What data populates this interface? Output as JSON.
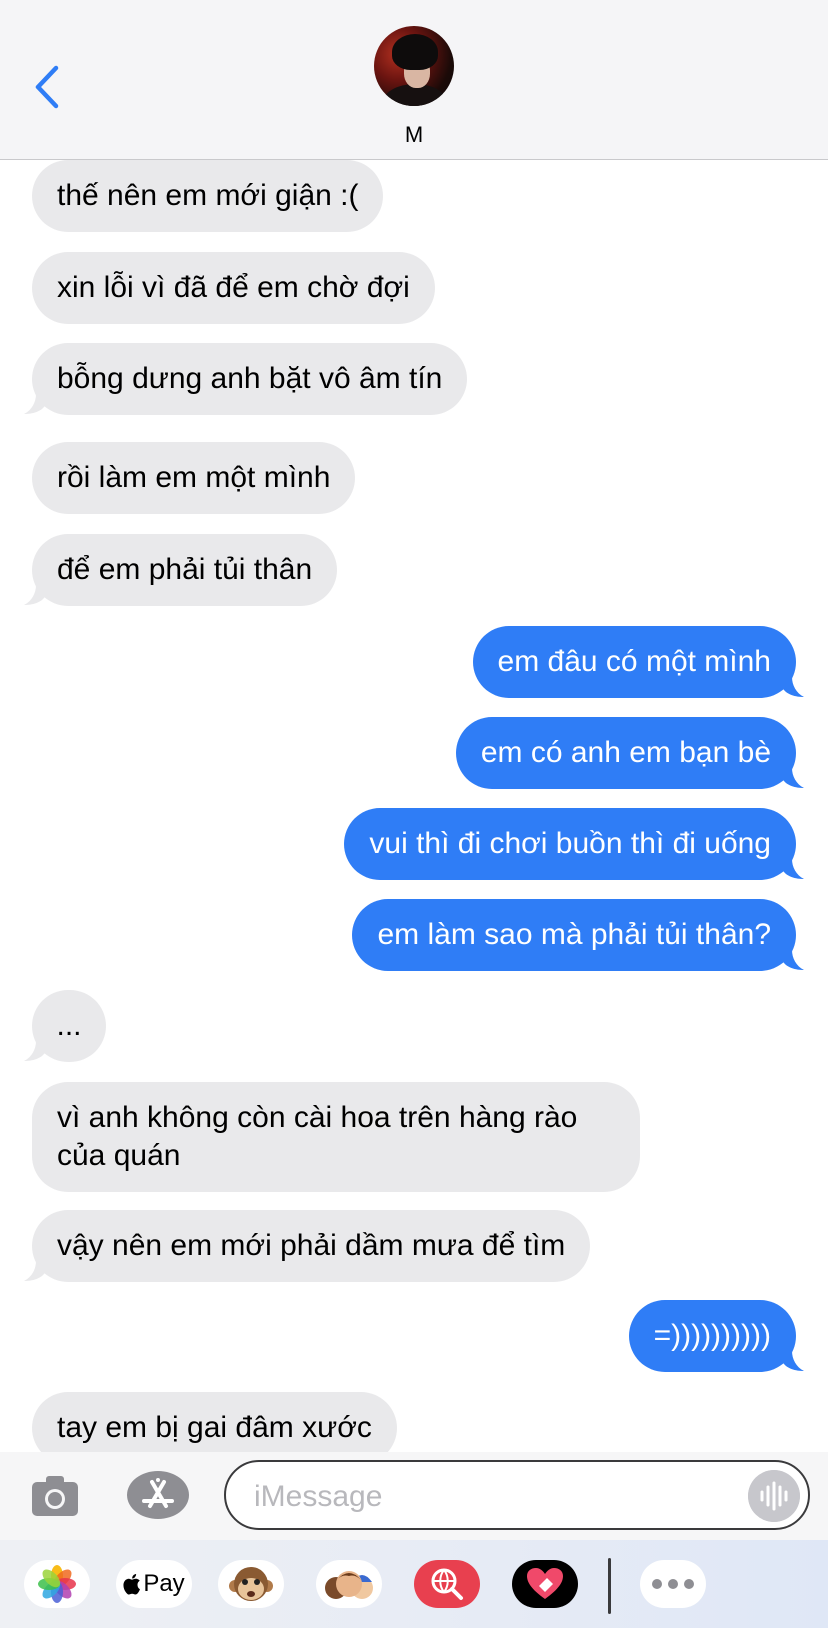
{
  "header": {
    "contact_name": "M"
  },
  "messages": [
    {
      "dir": "recv",
      "text": "thế nên em mới giận :("
    },
    {
      "dir": "recv",
      "text": "xin lỗi vì đã để em chờ đợi"
    },
    {
      "dir": "recv",
      "text": "bỗng dưng anh bặt vô âm tín"
    },
    {
      "dir": "recv",
      "text": "rồi làm em một mình"
    },
    {
      "dir": "recv",
      "text": "để em phải tủi thân"
    },
    {
      "dir": "sent",
      "text": "em đâu có một mình"
    },
    {
      "dir": "sent",
      "text": "em có anh em bạn bè"
    },
    {
      "dir": "sent",
      "text": "vui thì đi chơi buồn thì đi uống"
    },
    {
      "dir": "sent",
      "text": "em làm sao mà phải tủi thân?"
    },
    {
      "dir": "recv",
      "text": "..."
    },
    {
      "dir": "recv",
      "line1": "vì anh không còn cài hoa trên hàng rào",
      "line2": "của quán"
    },
    {
      "dir": "recv",
      "text": "vậy nên em mới phải dầm mưa để tìm"
    },
    {
      "dir": "sent",
      "text": "=))))))))))"
    },
    {
      "dir": "recv",
      "text": "tay em bị gai đâm xước"
    }
  ],
  "composer": {
    "placeholder": "iMessage"
  },
  "app_drawer": {
    "items": [
      {
        "name": "photos-app-icon",
        "label": ""
      },
      {
        "name": "apple-pay-app-icon",
        "label": "Pay"
      },
      {
        "name": "animoji-app-icon",
        "label": ""
      },
      {
        "name": "memoji-app-icon",
        "label": ""
      },
      {
        "name": "image-search-app-icon",
        "label": ""
      },
      {
        "name": "digital-touch-app-icon",
        "label": ""
      },
      {
        "name": "more-apps-icon",
        "label": ""
      }
    ]
  },
  "colors": {
    "sent": "#2f7df6",
    "received": "#e9e9eb",
    "accent": "#2f7df6"
  }
}
